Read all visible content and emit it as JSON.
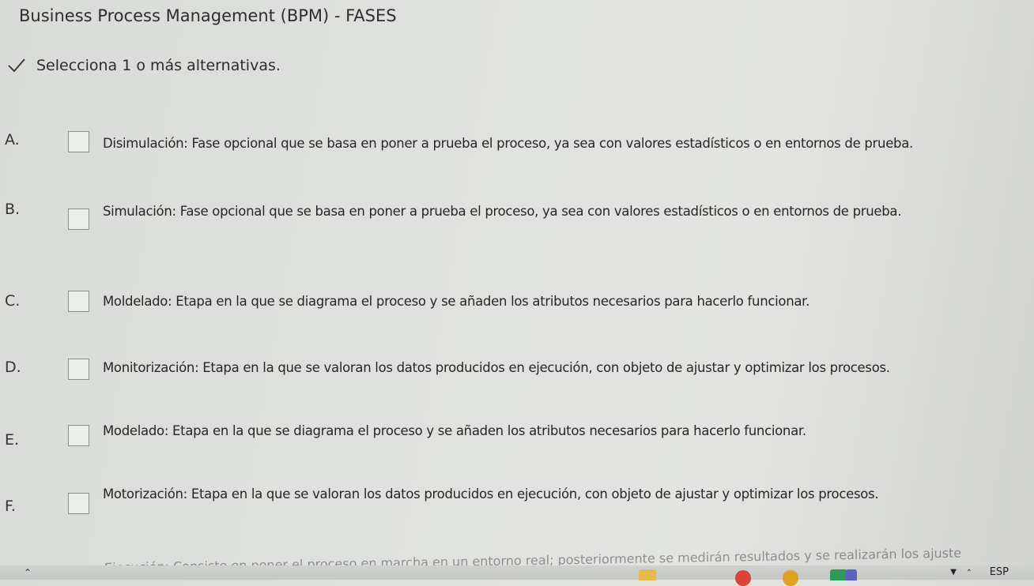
{
  "quiz": {
    "title": "Business Process Management (BPM) - FASES",
    "instruction": "Selecciona 1 o más alternativas.",
    "options": [
      {
        "letter": "A.",
        "text": "Disimulación: Fase opcional que se basa en poner a prueba el proceso, ya sea con valores estadísticos o en entornos de prueba.",
        "checked": false
      },
      {
        "letter": "B.",
        "text": "Simulación: Fase opcional que se basa en poner a prueba el proceso, ya sea con valores estadísticos o en entornos de prueba.",
        "checked": false
      },
      {
        "letter": "C.",
        "text": "Moldelado: Etapa en la que se diagrama el proceso y se añaden los atributos necesarios para hacerlo funcionar.",
        "checked": false
      },
      {
        "letter": "D.",
        "text": "Monitorización: Etapa en la que se valoran los datos producidos en ejecución, con objeto de ajustar y optimizar los procesos.",
        "checked": false
      },
      {
        "letter": "E.",
        "text": "Modelado: Etapa en la que se diagrama el proceso y se añaden los atributos necesarios para hacerlo funcionar.",
        "checked": false
      },
      {
        "letter": "F.",
        "text": "Motorización: Etapa en la que se valoran los datos producidos en ejecución, con objeto de ajustar y optimizar los procesos.",
        "checked": false
      }
    ],
    "cutoff_text": "Ejecución: Consiste en poner el proceso en marcha en un entorno real; posteriormente se medirán resultados y se realizarán los ajuste"
  },
  "taskbar": {
    "language": "ESP",
    "icons": [
      {
        "name": "file-explorer-icon",
        "color": "#e8b84a"
      },
      {
        "name": "chrome-icon",
        "color": "#d9443a"
      },
      {
        "name": "chrome-icon-2",
        "color": "#e0a020"
      },
      {
        "name": "app-green-icon",
        "color": "#2e9a57"
      },
      {
        "name": "teams-icon",
        "color": "#5b5fc7"
      }
    ]
  },
  "colors": {
    "background": "#e0e2df",
    "text": "#2a2a2a",
    "checkbox_border": "#8c8f8c"
  }
}
